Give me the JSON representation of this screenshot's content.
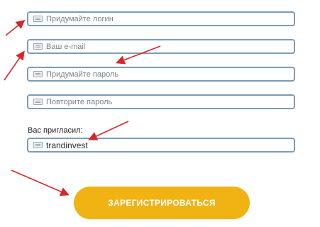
{
  "form": {
    "login_placeholder": "Придумайте логин",
    "email_placeholder": "Ваш e-mail",
    "password_placeholder": "Придумайте пароль",
    "password_repeat_placeholder": "Повторите пароль",
    "referrer_label": "Вас пригласил:",
    "referrer_value": "trandinvest",
    "register_button": "ЗАРЕГИСТРИРОВАТЬСЯ"
  },
  "icons": {
    "field_icon": "keyboard-icon",
    "annotation": "red-arrow-annotation"
  },
  "colors": {
    "field_border": "#7d9bb5",
    "button_bg": "#f1b314",
    "button_text": "#ffffff",
    "arrow": "#d9262c"
  }
}
